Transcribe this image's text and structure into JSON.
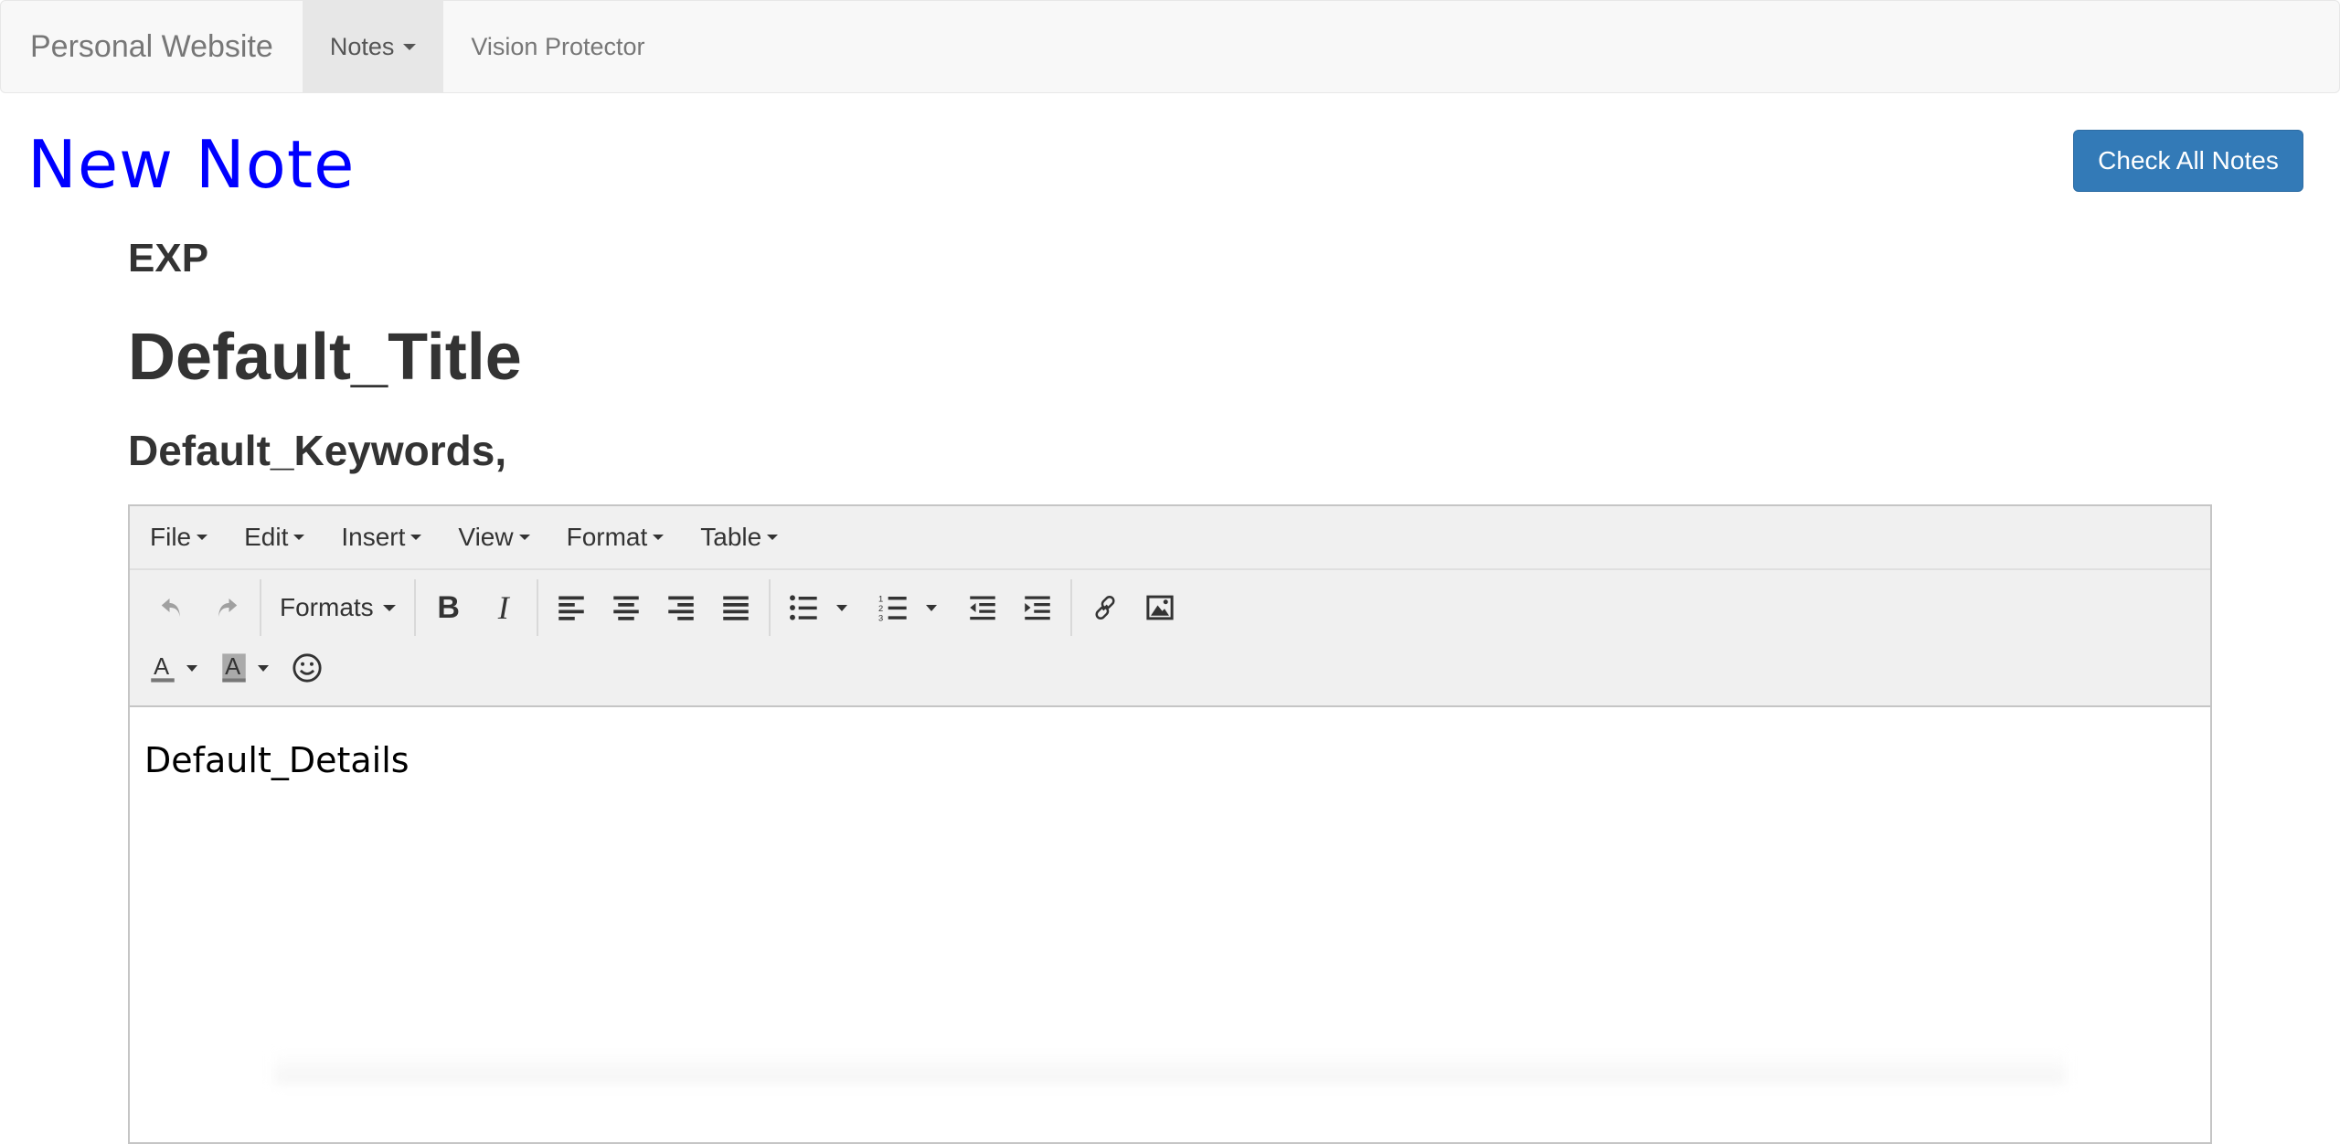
{
  "navbar": {
    "brand": "Personal Website",
    "items": [
      {
        "label": "Notes",
        "has_dropdown": true,
        "active": true
      },
      {
        "label": "Vision Protector",
        "has_dropdown": false,
        "active": false
      }
    ]
  },
  "page": {
    "heading": "New Note",
    "heading_color": "#0000ff",
    "check_all_button": "Check All Notes",
    "accent_color": "#337ab7"
  },
  "note": {
    "type": "EXP",
    "title": "Default_Title",
    "keywords": "Default_Keywords,",
    "details": "Default_Details"
  },
  "editor": {
    "menus": [
      "File",
      "Edit",
      "Insert",
      "View",
      "Format",
      "Table"
    ],
    "formats_label": "Formats",
    "toolbar_icons": [
      "undo-icon",
      "redo-icon",
      "bold-icon",
      "italic-icon",
      "align-left-icon",
      "align-center-icon",
      "align-right-icon",
      "align-justify-icon",
      "bullet-list-icon",
      "numbered-list-icon",
      "outdent-icon",
      "indent-icon",
      "link-icon",
      "image-icon",
      "text-color-icon",
      "background-color-icon",
      "emoticon-icon"
    ]
  }
}
